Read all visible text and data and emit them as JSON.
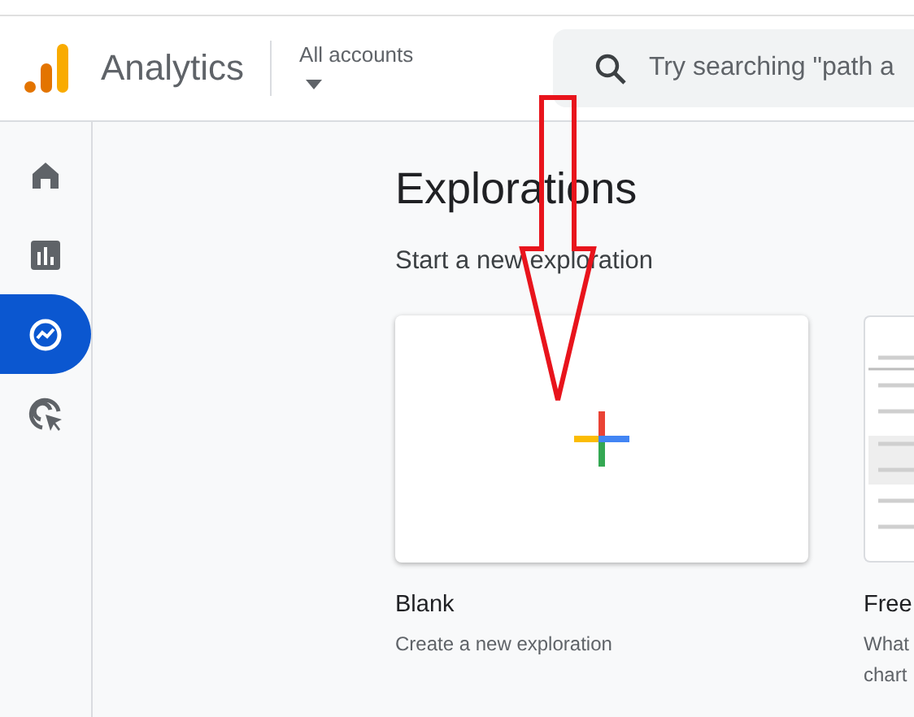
{
  "header": {
    "product": "Analytics",
    "account_label": "All accounts",
    "search": {
      "placeholder": "Try searching \"path a"
    }
  },
  "sidebar": {
    "items": [
      {
        "kind": "home",
        "selected": false
      },
      {
        "kind": "reports",
        "selected": false
      },
      {
        "kind": "explore",
        "selected": true
      },
      {
        "kind": "advertising",
        "selected": false
      }
    ]
  },
  "page": {
    "title": "Explorations",
    "subtitle": "Start a new exploration",
    "templates": [
      {
        "kind": "blank",
        "name": "Blank",
        "description": [
          "Create a new exploration"
        ]
      },
      {
        "kind": "freeform",
        "name": "Free",
        "description": [
          "What",
          "chart"
        ]
      }
    ]
  }
}
